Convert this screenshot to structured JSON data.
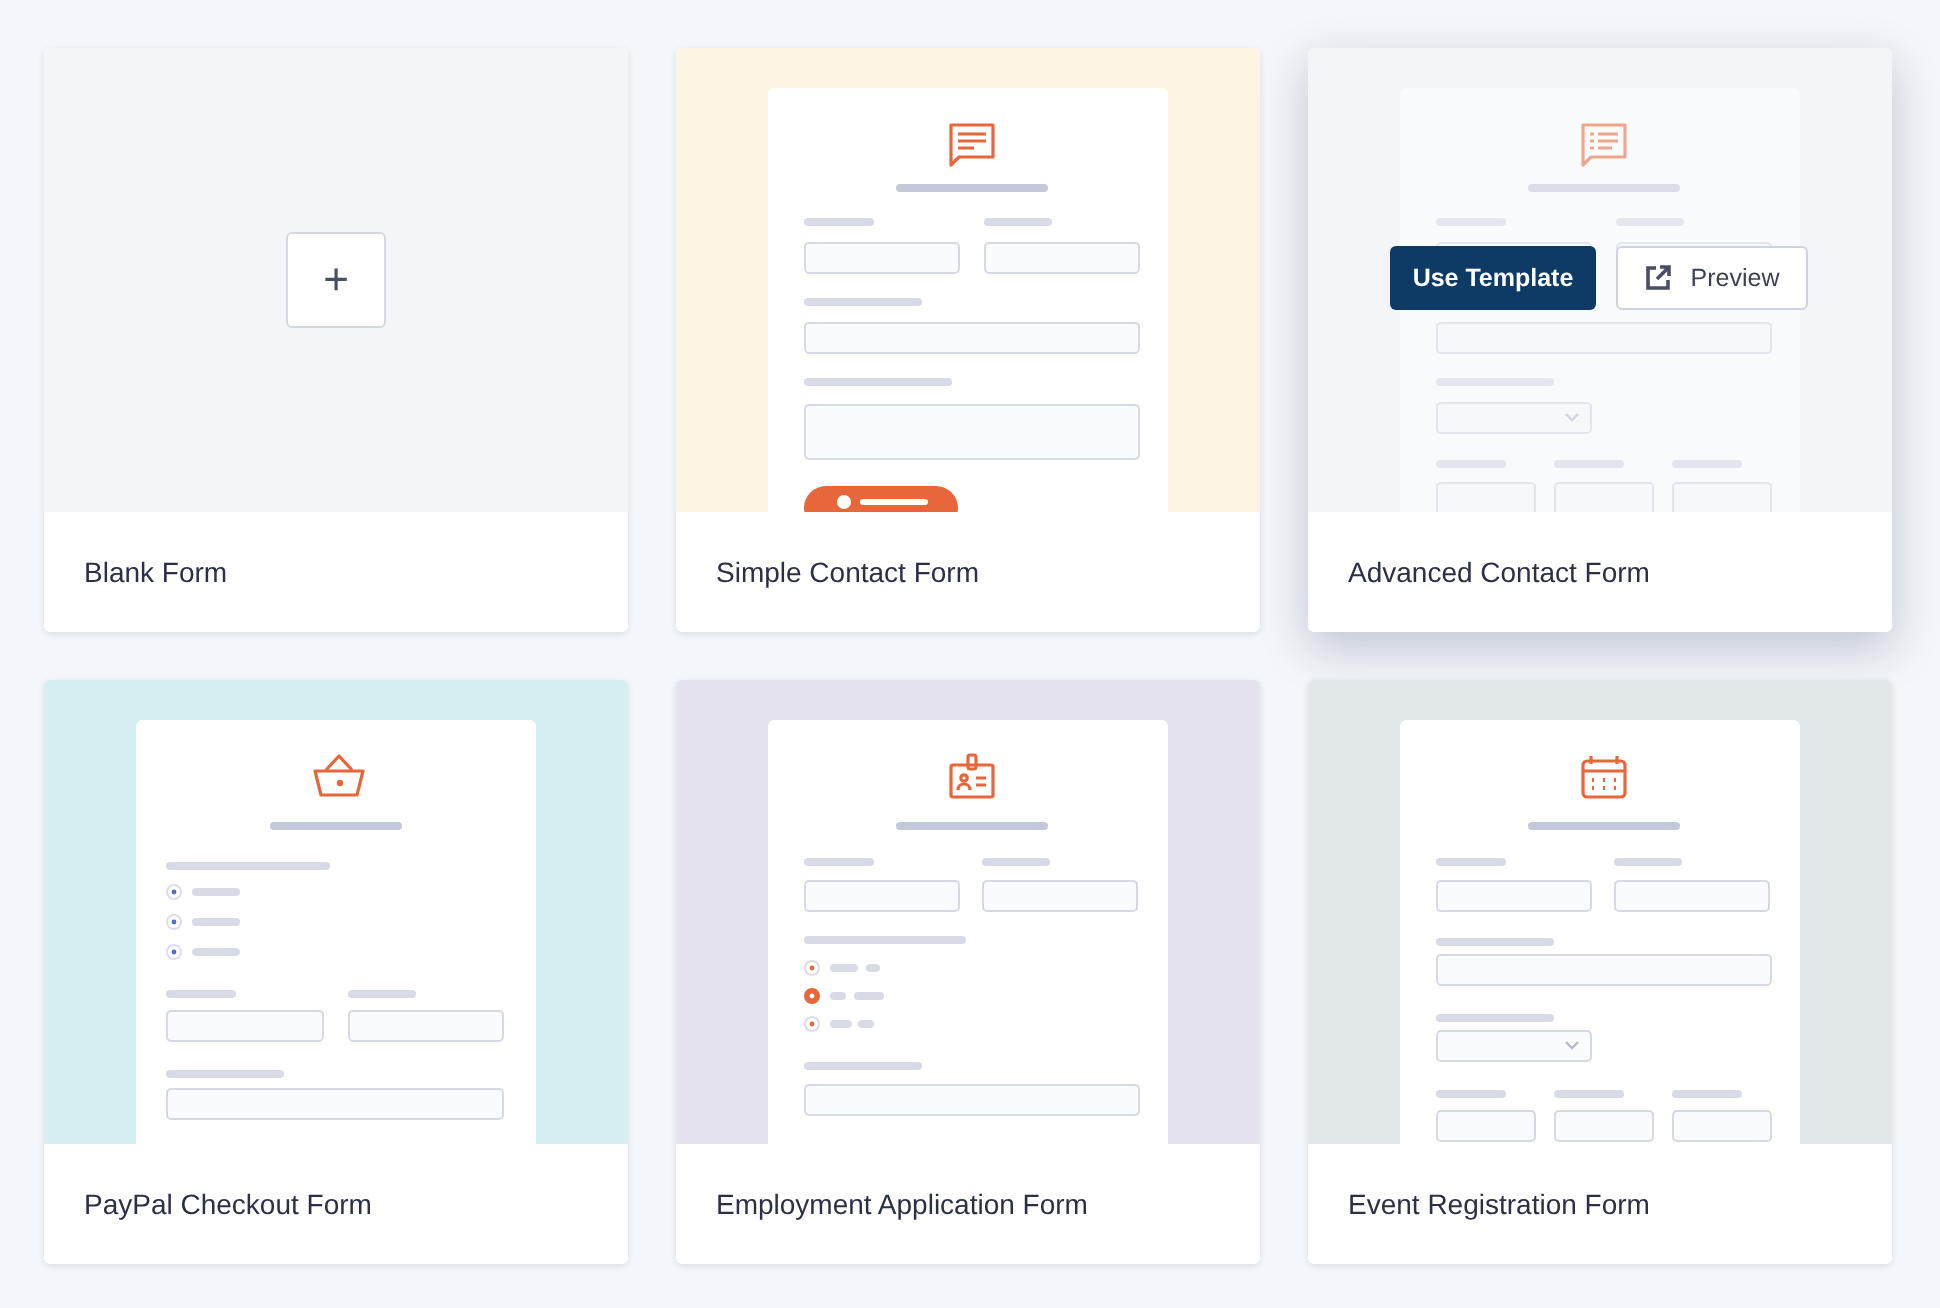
{
  "templates": [
    {
      "title": "Blank Form",
      "kind": "blank",
      "add_label": "+",
      "color": "#f3f5f9",
      "hovered": false
    },
    {
      "title": "Simple Contact Form",
      "kind": "contact",
      "color": "#fdf5e4",
      "hovered": false
    },
    {
      "title": "Advanced Contact Form",
      "kind": "advanced",
      "color": "#f3f5f9",
      "hovered": true,
      "actions": {
        "use": "Use Template",
        "preview": "Preview"
      }
    },
    {
      "title": "PayPal Checkout Form",
      "kind": "paypal",
      "color": "#d5eef1",
      "hovered": false
    },
    {
      "title": "Employment Application Form",
      "kind": "employment",
      "color": "#e5e3f0",
      "hovered": false
    },
    {
      "title": "Event Registration Form",
      "kind": "event",
      "color": "#e2e7ea",
      "hovered": false
    }
  ]
}
